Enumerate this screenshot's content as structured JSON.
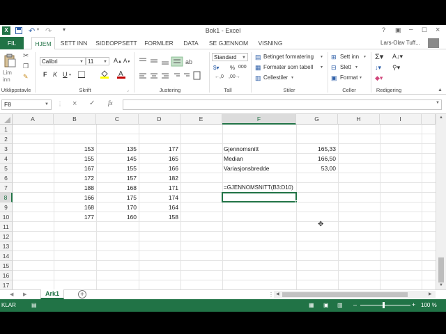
{
  "window": {
    "title": "Bok1 - Excel",
    "user": "Lars-Olav Tuff..."
  },
  "quick_access": {
    "undo_icon": "undo-icon",
    "redo_icon": "redo-icon"
  },
  "tabs": [
    {
      "label": "FIL"
    },
    {
      "label": "HJEM"
    },
    {
      "label": "SETT INN"
    },
    {
      "label": "SIDEOPPSETT"
    },
    {
      "label": "FORMLER"
    },
    {
      "label": "DATA"
    },
    {
      "label": "SE GJENNOM"
    },
    {
      "label": "VISNING"
    }
  ],
  "ribbon": {
    "clipboard": {
      "paste": "Lim inn",
      "label": "Utklippstavle"
    },
    "font": {
      "name": "Calibri",
      "size": "11",
      "bold": "F",
      "italic": "K",
      "underline": "U",
      "label": "Skrift",
      "font_color": "#c00000",
      "fill_color": "#ffff00"
    },
    "alignment": {
      "label": "Justering"
    },
    "number": {
      "format": "Standard",
      "percent": "%",
      "thousands": "000",
      "label": "Tall"
    },
    "styles": {
      "conditional": "Betinget formatering",
      "table": "Formater som tabell",
      "cell": "Cellestiler",
      "label": "Stiler"
    },
    "cells": {
      "insert": "Sett inn",
      "delete": "Slett",
      "format": "Format",
      "label": "Celler"
    },
    "editing": {
      "label": "Redigering"
    }
  },
  "formula_bar": {
    "name_box": "F8",
    "fx": "fx",
    "formula": ""
  },
  "columns": [
    "A",
    "B",
    "C",
    "D",
    "E",
    "F",
    "G",
    "H",
    "I"
  ],
  "selected_column": "F",
  "rows": [
    "1",
    "2",
    "3",
    "4",
    "5",
    "6",
    "7",
    "8",
    "9",
    "10",
    "11",
    "12",
    "13",
    "14",
    "15",
    "16",
    "17"
  ],
  "selected_row": "8",
  "data_values": {
    "row3": [
      "153",
      "135",
      "177"
    ],
    "row4": [
      "155",
      "145",
      "165"
    ],
    "row5": [
      "167",
      "155",
      "166"
    ],
    "row6": [
      "172",
      "157",
      "182"
    ],
    "row7": [
      "188",
      "168",
      "171"
    ],
    "row8": [
      "166",
      "175",
      "174"
    ],
    "row9": [
      "168",
      "170",
      "164"
    ],
    "row10": [
      "177",
      "160",
      "158"
    ]
  },
  "stats": [
    {
      "label": "Gjennomsnitt",
      "value": "165,33"
    },
    {
      "label": "Median",
      "value": "166,50"
    },
    {
      "label": "Variasjonsbredde",
      "value": "53,00"
    }
  ],
  "formula_text": "=GJENNOMSNITT(B3:D10)",
  "sheet_tabs": [
    {
      "label": "Ark1"
    }
  ],
  "status": {
    "mode": "KLAR",
    "zoom": "100 %"
  },
  "colors": {
    "accent": "#217346"
  }
}
